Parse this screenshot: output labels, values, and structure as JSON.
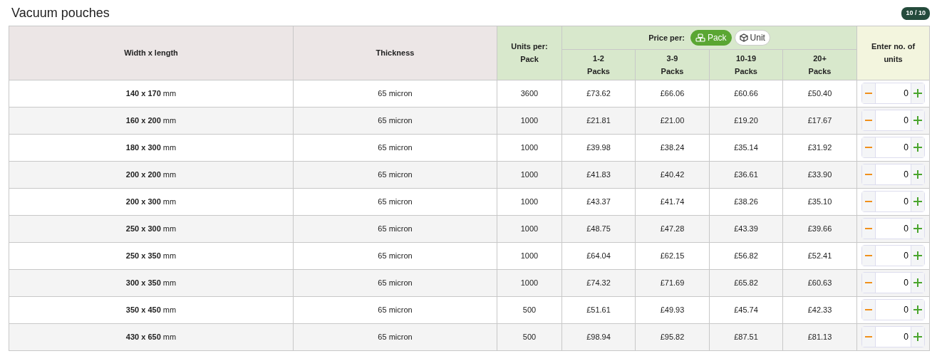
{
  "title": "Vacuum pouches",
  "counter": "10 / 10",
  "columns": {
    "size": "Width x length",
    "thickness": "Thickness",
    "units": "Units per: Pack",
    "price_label": "Price per:",
    "qty": "Enter no. of units"
  },
  "price_per": [
    {
      "label": "Pack",
      "selected": true
    },
    {
      "label": "Unit",
      "selected": false
    }
  ],
  "tiers": [
    "1-2 Packs",
    "3-9 Packs",
    "10-19 Packs",
    "20+ Packs"
  ],
  "rows": [
    {
      "size": "**140 x 170** mm",
      "thickness": "65 micron",
      "units": "3600",
      "prices": [
        "£73.62",
        "£66.06",
        "£60.66",
        "£50.40"
      ],
      "qty": "0"
    },
    {
      "size": "**160 x 200** mm",
      "thickness": "65 micron",
      "units": "1000",
      "prices": [
        "£21.81",
        "£21.00",
        "£19.20",
        "£17.67"
      ],
      "qty": "0"
    },
    {
      "size": "**180 x 300** mm",
      "thickness": "65 micron",
      "units": "1000",
      "prices": [
        "£39.98",
        "£38.24",
        "£35.14",
        "£31.92"
      ],
      "qty": "0"
    },
    {
      "size": "**200 x 200** mm",
      "thickness": "65 micron",
      "units": "1000",
      "prices": [
        "£41.83",
        "£40.42",
        "£36.61",
        "£33.90"
      ],
      "qty": "0"
    },
    {
      "size": "**200 x 300** mm",
      "thickness": "65 micron",
      "units": "1000",
      "prices": [
        "£43.37",
        "£41.74",
        "£38.26",
        "£35.10"
      ],
      "qty": "0"
    },
    {
      "size": "**250 x 300** mm",
      "thickness": "65 micron",
      "units": "1000",
      "prices": [
        "£48.75",
        "£47.28",
        "£43.39",
        "£39.66"
      ],
      "qty": "0"
    },
    {
      "size": "**250 x 350** mm",
      "thickness": "65 micron",
      "units": "1000",
      "prices": [
        "£64.04",
        "£62.15",
        "£56.82",
        "£52.41"
      ],
      "qty": "0"
    },
    {
      "size": "**300 x 350** mm",
      "thickness": "65 micron",
      "units": "1000",
      "prices": [
        "£74.32",
        "£71.69",
        "£65.82",
        "£60.63"
      ],
      "qty": "0"
    },
    {
      "size": "**350 x 450** mm",
      "thickness": "65 micron",
      "units": "500",
      "prices": [
        "£51.61",
        "£49.93",
        "£45.74",
        "£42.33"
      ],
      "qty": "0"
    },
    {
      "size": "**430 x 650** mm",
      "thickness": "65 micron",
      "units": "500",
      "prices": [
        "£98.94",
        "£95.82",
        "£87.51",
        "£81.13"
      ],
      "qty": "0"
    }
  ]
}
